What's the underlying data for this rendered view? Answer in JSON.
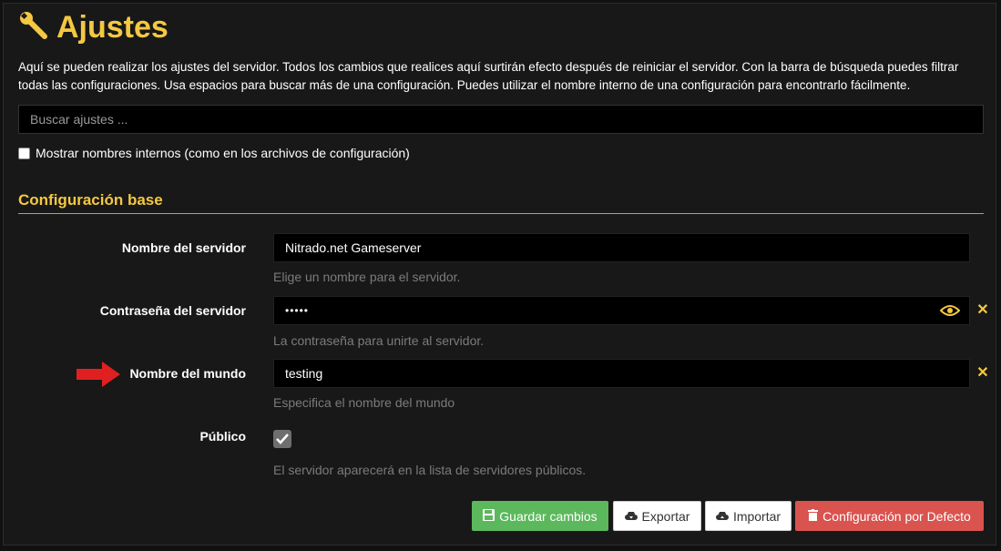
{
  "page": {
    "title": "Ajustes",
    "intro": "Aquí se pueden realizar los ajustes del servidor. Todos los cambios que realices aquí surtirán efecto después de reiniciar el servidor. Con la barra de búsqueda puedes filtrar todas las configuraciones. Usa espacios para buscar más de una configuración. Puedes utilizar el nombre interno de una configuración para encontrarlo fácilmente."
  },
  "search": {
    "placeholder": "Buscar ajustes ..."
  },
  "show_internal": {
    "label": "Mostrar nombres internos (como en los archivos de configuración)",
    "checked": false
  },
  "section": {
    "title": "Configuración base"
  },
  "fields": {
    "server_name": {
      "label": "Nombre del servidor",
      "value": "Nitrado.net Gameserver",
      "help": "Elige un nombre para el servidor."
    },
    "server_password": {
      "label": "Contraseña del servidor",
      "value": "•••••",
      "help": "La contraseña para unirte al servidor."
    },
    "world_name": {
      "label": "Nombre del mundo",
      "value": "testing",
      "help": "Especifica el nombre del mundo"
    },
    "public": {
      "label": "Público",
      "checked": true,
      "help": "El servidor aparecerá en la lista de servidores públicos."
    }
  },
  "buttons": {
    "save": "Guardar cambios",
    "export": "Exportar",
    "import": "Importar",
    "default": "Configuración por Defecto"
  },
  "colors": {
    "accent": "#f5c842",
    "save": "#5cb85c",
    "danger": "#d9534f",
    "annotation_arrow": "#e02020"
  }
}
